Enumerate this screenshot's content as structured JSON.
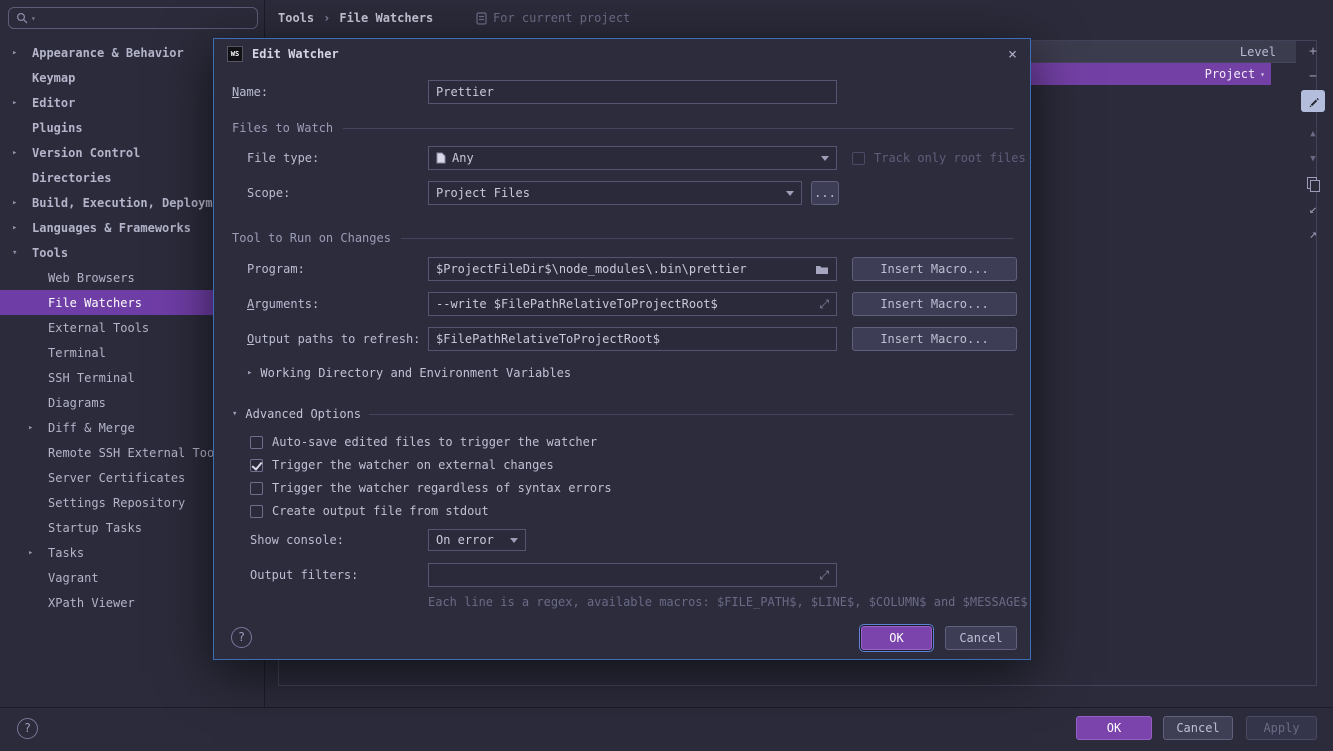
{
  "colors": {
    "accent_purple": "#7b44ad",
    "selection_purple": "#6f3da6",
    "focus_blue": "#3e6db8",
    "window_bg": "#2b2b3b"
  },
  "icons": {
    "close": "×",
    "caret_down": "▾",
    "chevron_collapsed": "▸",
    "chevron_expanded": "▾",
    "expand_arrows": "⤢",
    "plus": "+",
    "minus": "−",
    "move_up": "▲",
    "move_down": "▼",
    "import_arrow": "↙",
    "export_arrow": "↗",
    "help": "?"
  },
  "search": {
    "placeholder": ""
  },
  "breadcrumbs": {
    "path": [
      "Tools",
      "File Watchers"
    ],
    "separator": "›",
    "context_note": "For current project"
  },
  "sidebar": {
    "items": [
      {
        "label": "Appearance & Behavior"
      },
      {
        "label": "Keymap"
      },
      {
        "label": "Editor"
      },
      {
        "label": "Plugins"
      },
      {
        "label": "Version Control"
      },
      {
        "label": "Directories"
      },
      {
        "label": "Build, Execution, Deployment"
      },
      {
        "label": "Languages & Frameworks"
      },
      {
        "label": "Tools"
      },
      {
        "label": "Web Browsers"
      },
      {
        "label": "File Watchers"
      },
      {
        "label": "External Tools"
      },
      {
        "label": "Terminal"
      },
      {
        "label": "SSH Terminal"
      },
      {
        "label": "Diagrams"
      },
      {
        "label": "Diff & Merge"
      },
      {
        "label": "Remote SSH External Tools"
      },
      {
        "label": "Server Certificates"
      },
      {
        "label": "Settings Repository"
      },
      {
        "label": "Startup Tasks"
      },
      {
        "label": "Tasks"
      },
      {
        "label": "Vagrant"
      },
      {
        "label": "XPath Viewer"
      }
    ]
  },
  "watchers": {
    "level_header": "Level",
    "selected_level": "Project"
  },
  "dialog": {
    "logo": "WS",
    "title": "Edit Watcher",
    "name_label": "Name:",
    "name_value": "Prettier",
    "files_section": "Files to Watch",
    "file_type_label": "File type:",
    "file_type_value": "Any",
    "track_only_root_label": "Track only root files",
    "scope_label": "Scope:",
    "scope_value": "Project Files",
    "browse_label": "...",
    "tool_section": "Tool to Run on Changes",
    "program_label": "Program:",
    "program_value": "$ProjectFileDir$\\node_modules\\.bin\\prettier",
    "arguments_label": "Arguments:",
    "arguments_value": "--write $FilePathRelativeToProjectRoot$",
    "output_paths_label": "Output paths to refresh:",
    "output_paths_value": "$FilePathRelativeToProjectRoot$",
    "insert_macro_label": "Insert Macro...",
    "working_dir_toggle": "Working Directory and Environment Variables",
    "advanced_toggle": "Advanced Options",
    "checkboxes": [
      {
        "label": "Auto-save edited files to trigger the watcher",
        "checked": false
      },
      {
        "label": "Trigger the watcher on external changes",
        "checked": true
      },
      {
        "label": "Trigger the watcher regardless of syntax errors",
        "checked": false
      },
      {
        "label": "Create output file from stdout",
        "checked": false
      }
    ],
    "show_console_label": "Show console:",
    "show_console_value": "On error",
    "output_filters_label": "Output filters:",
    "output_filters_value": "",
    "filters_hint": "Each line is a regex, available macros: $FILE_PATH$, $LINE$, $COLUMN$ and $MESSAGE$",
    "ok": "OK",
    "cancel": "Cancel"
  },
  "footer": {
    "ok": "OK",
    "cancel": "Cancel",
    "apply": "Apply",
    "help": "?"
  }
}
